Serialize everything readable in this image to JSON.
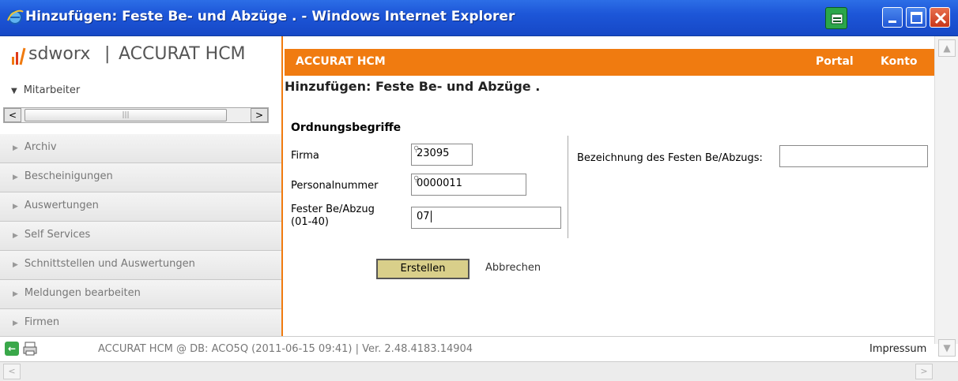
{
  "window": {
    "title": "Hinzufügen: Feste Be- und Abzüge . - Windows Internet Explorer"
  },
  "sidebar": {
    "logo_company": "sdworx",
    "logo_separator": "|",
    "logo_app": "ACCURAT HCM",
    "section": "Mitarbeiter",
    "items": [
      {
        "label": "Archiv"
      },
      {
        "label": "Bescheinigungen"
      },
      {
        "label": "Auswertungen"
      },
      {
        "label": "Self Services"
      },
      {
        "label": "Schnittstellen und Auswertungen"
      },
      {
        "label": "Meldungen bearbeiten"
      },
      {
        "label": "Firmen"
      }
    ]
  },
  "topbar": {
    "brand": "ACCURAT HCM",
    "portal": "Portal",
    "konto": "Konto"
  },
  "form": {
    "title": "Hinzufügen: Feste Be- und Abzüge .",
    "section": "Ordnungsbegriffe",
    "firma_label": "Firma",
    "firma_value": "23095",
    "personalnummer_label": "Personalnummer",
    "personalnummer_value": "0000011",
    "fester_label_1": "Fester Be/Abzug",
    "fester_label_2": "(01-40)",
    "fester_value": "07",
    "bezeichnung_label": "Bezeichnung des Festen Be/Abzugs:",
    "bezeichnung_value": "",
    "create_button": "Erstellen",
    "cancel_link": "Abbrechen"
  },
  "status": {
    "info": "ACCURAT HCM @ DB: ACO5Q (2011-06-15 09:41) | Ver. 2.48.4183.14904",
    "impressum": "Impressum"
  },
  "colors": {
    "accent": "#f07b10",
    "titlebar": "#1d56d8",
    "create_button": "#d9cf8a"
  }
}
